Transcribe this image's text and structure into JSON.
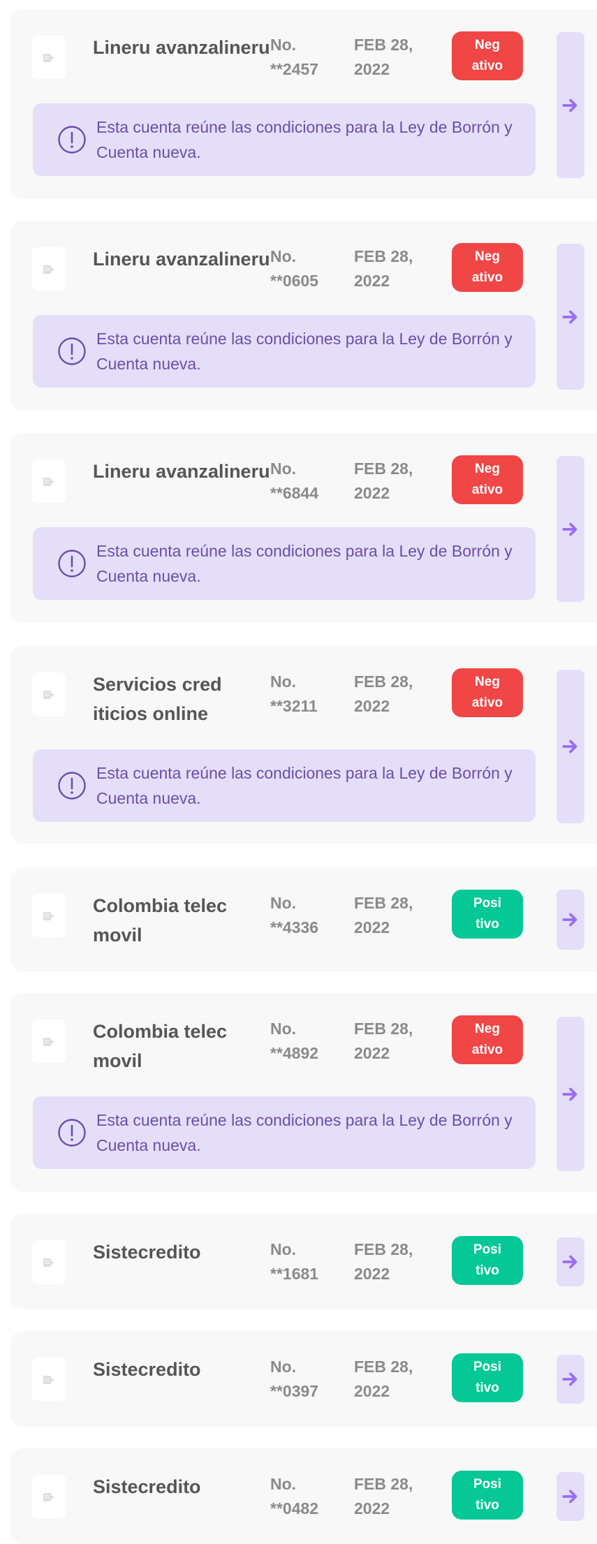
{
  "notice_text": "Esta cuenta reúne las condiciones para la Ley de Borrón y Cuenta nueva.",
  "colors": {
    "negative": "#f04646",
    "positive": "#05c896",
    "notice_bg": "#e5def9",
    "notice_fg": "#6b4ea8",
    "arrow": "#9a6cf5"
  },
  "icons": {
    "logo": "company-logo-icon",
    "notice": "exclamation-circle-icon",
    "arrow": "arrow-right-icon"
  },
  "accounts": [
    {
      "name": "Lineru avanzalineru",
      "account": "No.\n**2457",
      "date": "FEB 28,\n2022",
      "status": "Neg\nativo",
      "status_type": "negative",
      "eligible": true
    },
    {
      "name": "Lineru avanzalineru",
      "account": "No.\n**0605",
      "date": "FEB 28,\n2022",
      "status": "Neg\nativo",
      "status_type": "negative",
      "eligible": true
    },
    {
      "name": "Lineru avanzalineru",
      "account": "No.\n**6844",
      "date": "FEB 28,\n2022",
      "status": "Neg\nativo",
      "status_type": "negative",
      "eligible": true
    },
    {
      "name": "Servicios cred\niticios online",
      "account": "No.\n**3211",
      "date": "FEB 28,\n2022",
      "status": "Neg\nativo",
      "status_type": "negative",
      "eligible": true
    },
    {
      "name": "Colombia telec\nmovil",
      "account": "No.\n**4336",
      "date": "FEB 28,\n2022",
      "status": "Posi\ntivo",
      "status_type": "positive",
      "eligible": false
    },
    {
      "name": "Colombia telec\nmovil",
      "account": "No.\n**4892",
      "date": "FEB 28,\n2022",
      "status": "Neg\nativo",
      "status_type": "negative",
      "eligible": true
    },
    {
      "name": "Sistecredito",
      "account": "No.\n**1681",
      "date": "FEB 28,\n2022",
      "status": "Posi\ntivo",
      "status_type": "positive",
      "eligible": false
    },
    {
      "name": "Sistecredito",
      "account": "No.\n**0397",
      "date": "FEB 28,\n2022",
      "status": "Posi\ntivo",
      "status_type": "positive",
      "eligible": false
    },
    {
      "name": "Sistecredito",
      "account": "No.\n**0482",
      "date": "FEB 28,\n2022",
      "status": "Posi\ntivo",
      "status_type": "positive",
      "eligible": false
    }
  ]
}
